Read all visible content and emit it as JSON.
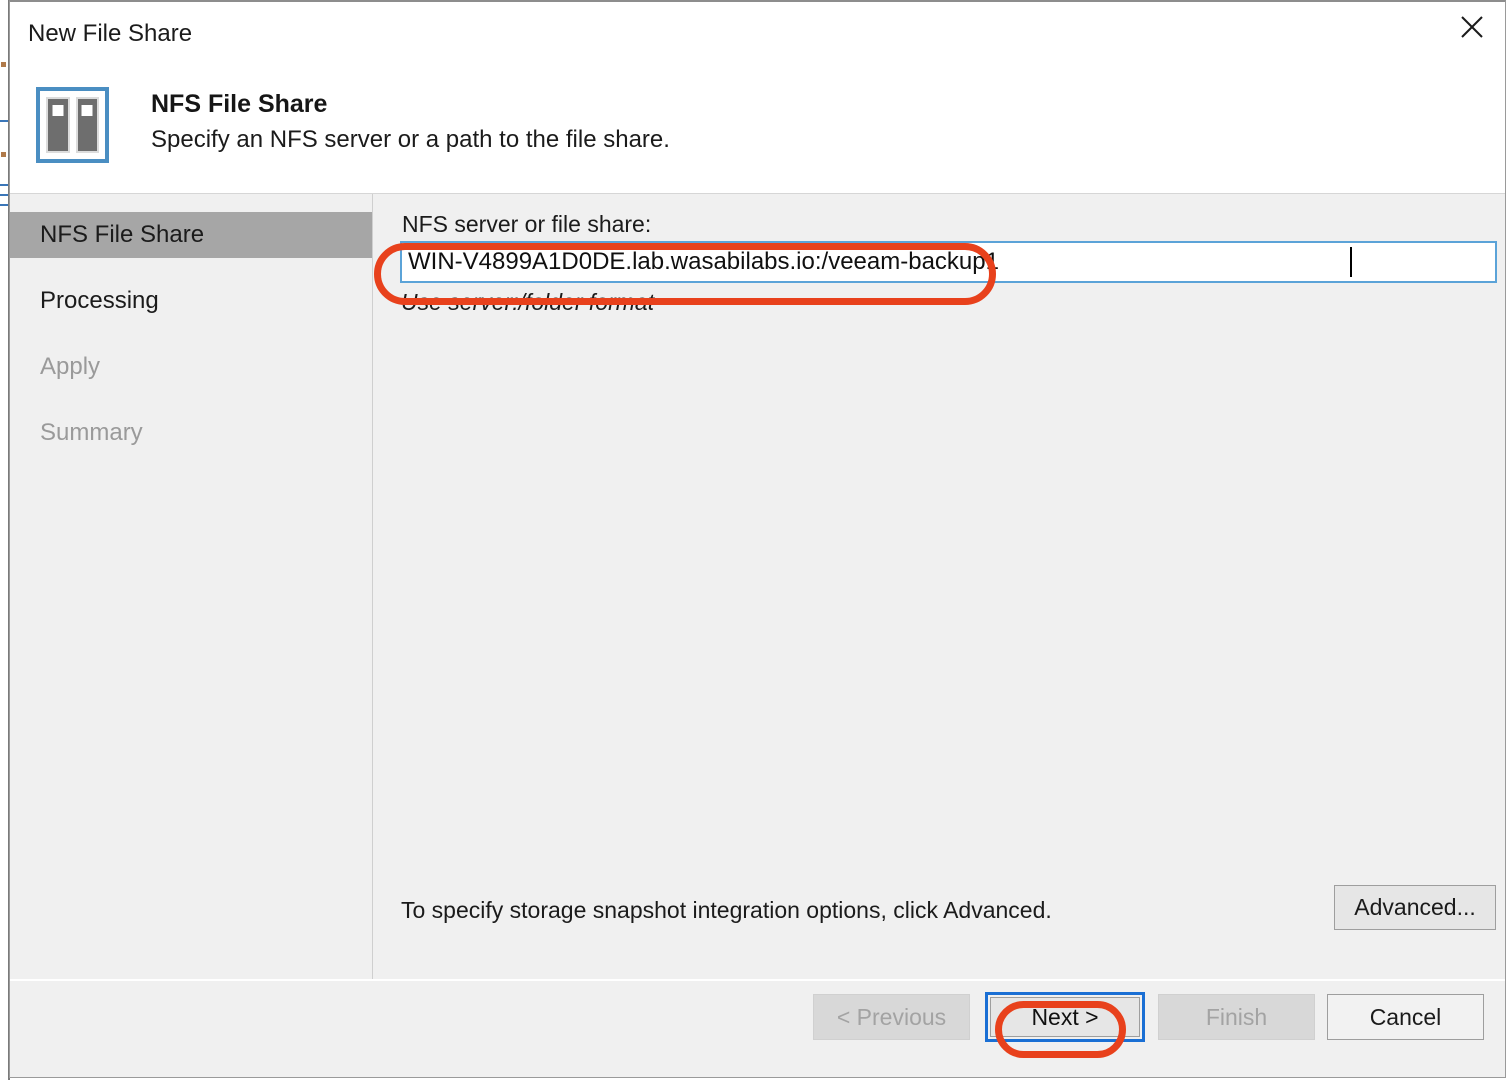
{
  "window": {
    "title": "New File Share",
    "close_icon": "close-icon"
  },
  "header": {
    "title": "NFS File Share",
    "subtitle": "Specify an NFS server or a path to the file share.",
    "icon": "file-share-icon"
  },
  "sidebar": {
    "items": [
      {
        "label": "NFS File Share",
        "state": "active"
      },
      {
        "label": "Processing",
        "state": "enabled"
      },
      {
        "label": "Apply",
        "state": "disabled"
      },
      {
        "label": "Summary",
        "state": "disabled"
      }
    ]
  },
  "main": {
    "field_label": "NFS server or file share:",
    "input_value": "WIN-V4899A1D0DE.lab.wasabilabs.io:/veeam-backup1",
    "input_placeholder": "",
    "hint": "Use server:/folder format",
    "advanced_text": "To specify storage snapshot integration options, click Advanced.",
    "advanced_button": "Advanced..."
  },
  "footer": {
    "previous": "< Previous",
    "next": "Next >",
    "finish": "Finish",
    "cancel": "Cancel"
  },
  "annotations": {
    "color": "#e8411c",
    "targets": [
      "nfs-server-input",
      "next-button"
    ]
  },
  "colors": {
    "accent_blue": "#1a6fd4",
    "input_border": "#5ba3d8",
    "icon_blue": "#4a8ec2",
    "dialog_bg": "#f0f0f0",
    "active_nav": "#a6a6a6",
    "annotation_red": "#e8411c"
  }
}
